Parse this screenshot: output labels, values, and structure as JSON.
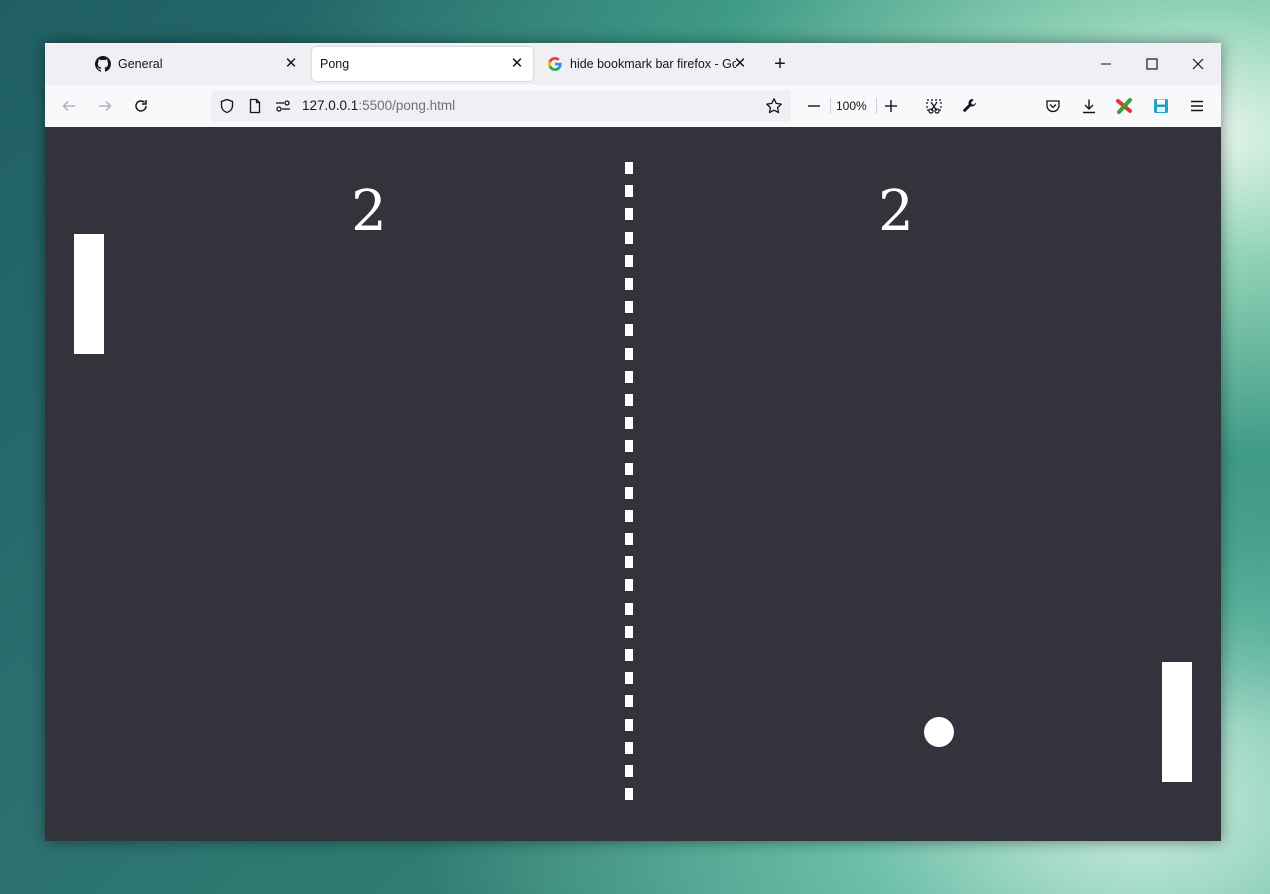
{
  "browser": {
    "tabs": [
      {
        "label": "General",
        "icon": "github-icon",
        "active": false
      },
      {
        "label": "Pong",
        "icon": "",
        "active": true
      },
      {
        "label": "hide bookmark bar firefox - Goo",
        "icon": "google-icon",
        "active": false
      }
    ],
    "url_host": "127.0.0.1",
    "url_rest": ":5500/pong.html",
    "zoom": "100%"
  },
  "game": {
    "score_left": "2",
    "score_right": "2",
    "colors": {
      "background": "#33333b",
      "foreground": "#ffffff"
    }
  }
}
